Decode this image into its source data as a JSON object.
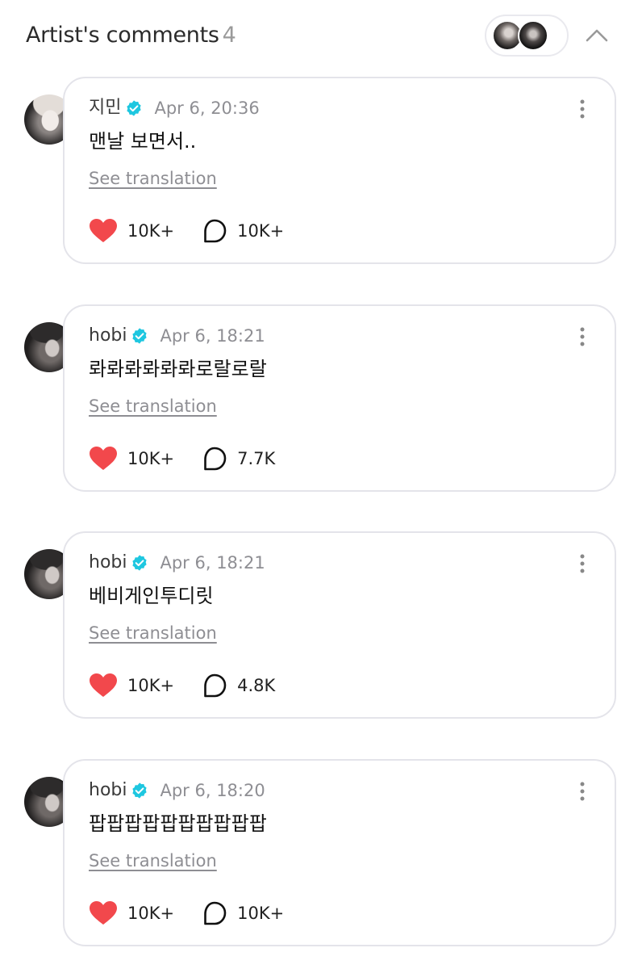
{
  "header": {
    "title": "Artist's comments",
    "count": "4"
  },
  "colors": {
    "verified": "#1ec7e0",
    "heart": "#f2484c",
    "muted": "#8e8e93",
    "card_border": "#e4e4ea"
  },
  "comments": [
    {
      "author": "지민",
      "date": "Apr 6, 20:36",
      "text": "맨날 보면서..",
      "translate_label": "See translation",
      "likes": "10K+",
      "replies": "10K+",
      "avatar": "jimin"
    },
    {
      "author": "hobi",
      "date": "Apr 6, 18:21",
      "text": "롸롸롸롸롸롸로랄로랄",
      "translate_label": "See translation",
      "likes": "10K+",
      "replies": "7.7K",
      "avatar": "hobi"
    },
    {
      "author": "hobi",
      "date": "Apr 6, 18:21",
      "text": "베비게인투디릿",
      "translate_label": "See translation",
      "likes": "10K+",
      "replies": "4.8K",
      "avatar": "hobi"
    },
    {
      "author": "hobi",
      "date": "Apr 6, 18:20",
      "text": "팝팝팝팝팝팝팝팝팝팝",
      "translate_label": "See translation",
      "likes": "10K+",
      "replies": "10K+",
      "avatar": "hobi"
    }
  ]
}
